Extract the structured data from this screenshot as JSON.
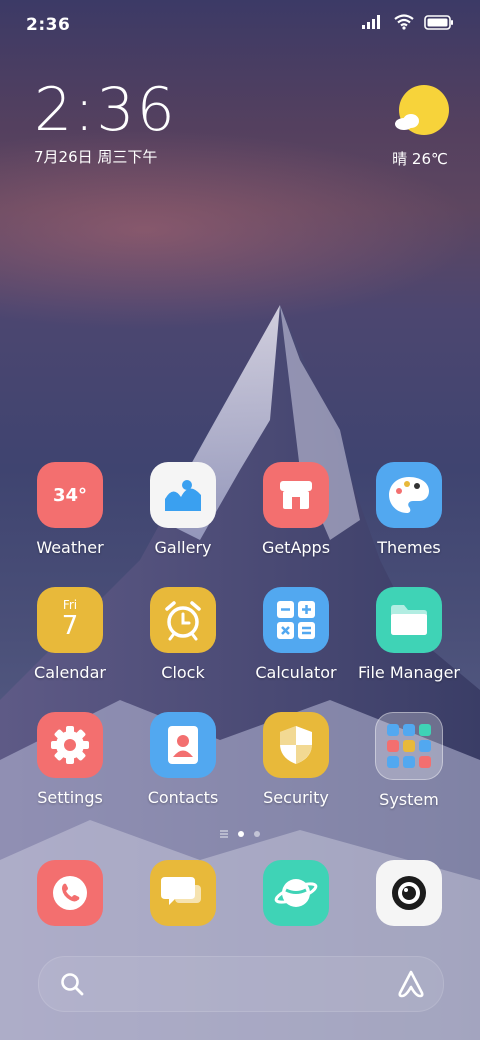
{
  "status_bar": {
    "time": "2:36"
  },
  "clock_widget": {
    "time": "2:36",
    "date": "7月26日 周三下午"
  },
  "weather_widget": {
    "text": "晴 26℃"
  },
  "apps": [
    {
      "label": "Weather",
      "icon": "weather-icon",
      "badge_text": "34°",
      "color": "#f36f6f"
    },
    {
      "label": "Gallery",
      "icon": "gallery-icon",
      "color": "#f5f5f5"
    },
    {
      "label": "GetApps",
      "icon": "getapps-icon",
      "color": "#f36f6f"
    },
    {
      "label": "Themes",
      "icon": "themes-icon",
      "color": "#52a8f0"
    },
    {
      "label": "Calendar",
      "icon": "calendar-icon",
      "day_name": "Fri",
      "day_number": "7",
      "color": "#e8b93a"
    },
    {
      "label": "Clock",
      "icon": "clock-icon",
      "color": "#e8b93a"
    },
    {
      "label": "Calculator",
      "icon": "calculator-icon",
      "color": "#52a8f0"
    },
    {
      "label": "File Manager",
      "icon": "file-manager-icon",
      "color": "#3fd3b6"
    },
    {
      "label": "Settings",
      "icon": "settings-icon",
      "color": "#f36f6f"
    },
    {
      "label": "Contacts",
      "icon": "contacts-icon",
      "color": "#52a8f0"
    },
    {
      "label": "Security",
      "icon": "security-icon",
      "color": "#e8b93a"
    },
    {
      "label": "System",
      "icon": "folder-icon",
      "color": "#ffffff"
    }
  ],
  "dock": [
    {
      "icon": "phone-icon",
      "color": "#f36f6f"
    },
    {
      "icon": "messages-icon",
      "color": "#e8b93a"
    },
    {
      "icon": "browser-icon",
      "color": "#3fd3b6"
    },
    {
      "icon": "camera-icon",
      "color": "#f5f5f5"
    }
  ],
  "page_indicator": {
    "pages": 2,
    "current": 1
  }
}
